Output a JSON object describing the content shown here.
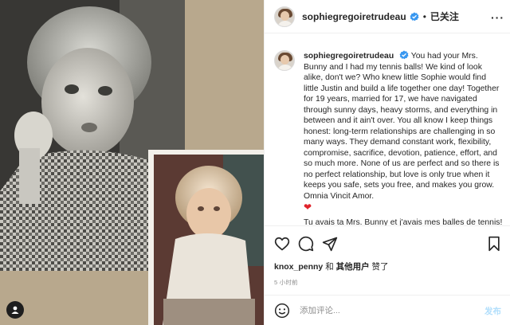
{
  "post": {
    "username": "sophiegregoiretrudeau",
    "separator": "•",
    "follow_status": "已关注",
    "more_label": "···",
    "caption_user": "sophiegregoiretrudeau",
    "caption_body": "You had your Mrs. Bunny and I had my tennis balls! We kind of look alike, don't we? Who knew little Sophie would find little Justin and build a life together one day! Together for 19 years, married for 17, we have navigated through sunny days, heavy storms, and everything in between and it ain't over. You all know I keep things honest: long-term relationships are challenging in so many ways. They demand constant work, flexibility, compromise, sacrifice, devotion, patience, effort, and so much more. None of us are perfect and so there is no perfect relationship, but love is only true when it keeps you safe, sets you free, and makes you grow. Omnia Vincit Amor.",
    "caption_emoji": "❤",
    "caption_french": "Tu avais ta Mrs. Bunny et j'avais mes balles de tennis! On se ressemble un peu, non?",
    "likes_user": "knox_penny",
    "likes_connector": " 和 ",
    "likes_others": "其他用户",
    "likes_suffix": " 赞了",
    "timestamp": "5 小时前",
    "comment_placeholder": "添加评论...",
    "post_label": "发布"
  },
  "icons": {
    "like": "heart-icon",
    "comment": "comment-icon",
    "share": "share-icon",
    "save": "bookmark-icon",
    "emoji": "emoji-icon",
    "tagged": "user-tag-icon",
    "verified": "verified-badge-icon"
  },
  "colors": {
    "verified_blue": "#3897f0",
    "post_disabled": "#b2dffc",
    "heart_red": "#e0242c"
  }
}
